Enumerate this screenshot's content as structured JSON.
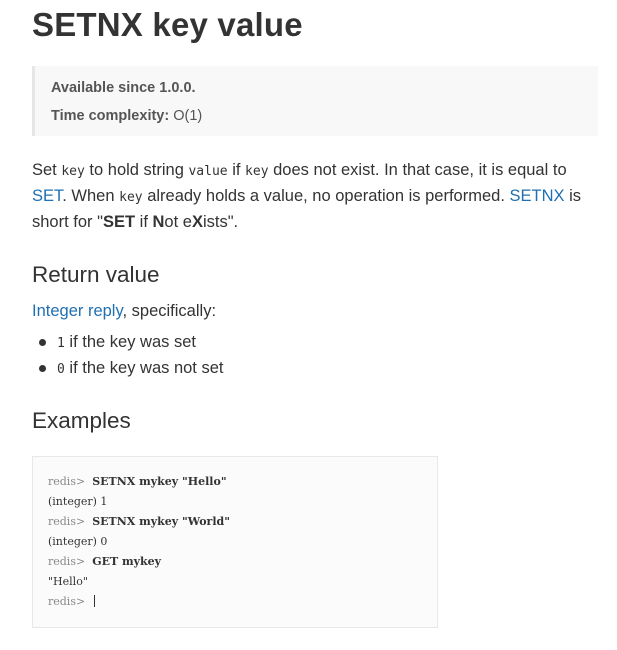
{
  "title": "SETNX key value",
  "metadata": {
    "available_label": "Available since 1.0.0.",
    "complexity_label": "Time complexity:",
    "complexity_value": "O(1)"
  },
  "description": {
    "t1": "Set ",
    "code_key1": "key",
    "t2": " to hold string ",
    "code_value": "value",
    "t3": " if ",
    "code_key2": "key",
    "t4": " does not exist. In that case, it is equal to ",
    "link_set": "SET",
    "t5": ". When ",
    "code_key3": "key",
    "t6": " already holds a value, no operation is performed. ",
    "link_setnx": "SETNX",
    "t7": " is short for \"",
    "b1": "SET",
    "t8": " if ",
    "b2": "N",
    "t9": "ot e",
    "b3": "X",
    "t10": "ists\"."
  },
  "return_value": {
    "heading": "Return value",
    "link": "Integer reply",
    "suffix": ", specifically:",
    "items": [
      {
        "code": "1",
        "text": " if the key was set"
      },
      {
        "code": "0",
        "text": " if the key was not set"
      }
    ]
  },
  "examples": {
    "heading": "Examples",
    "prompt": "redis>",
    "lines": [
      {
        "command": "SETNX mykey \"Hello\""
      },
      {
        "output": "(integer) 1"
      },
      {
        "command": "SETNX mykey \"World\""
      },
      {
        "output": "(integer) 0"
      },
      {
        "command": "GET mykey"
      },
      {
        "output": "\"Hello\""
      }
    ]
  }
}
